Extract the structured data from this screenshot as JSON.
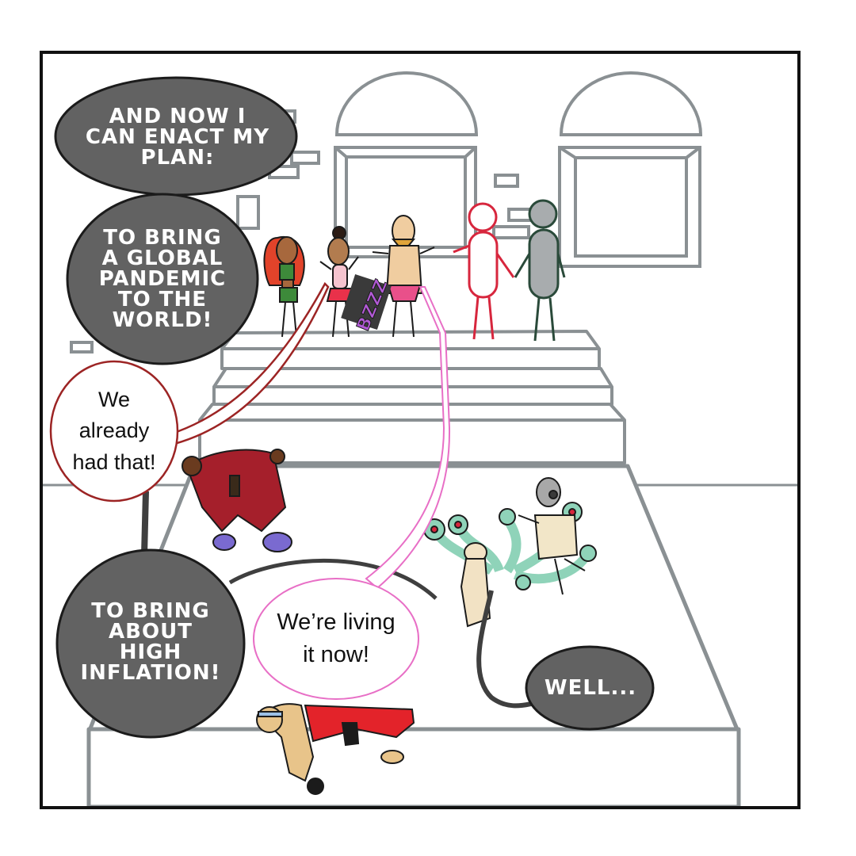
{
  "colors": {
    "caption_fill": "#626262",
    "caption_text": "#ffffff",
    "building_line": "#8a9093",
    "panel_border": "#111111",
    "speech_red": "#9c2424",
    "speech_pink": "#e86fc6"
  },
  "captions": {
    "top": "And now I\ncan enact my\nplan:",
    "pandemic": "To bring\na global\npandemic\nto the\nworld!",
    "inflation": "To bring\nabout\nhigh\ninflation!",
    "well": "Well..."
  },
  "speech": {
    "already": "We\nalready\nhad that!",
    "living": "We’re living\nit now!"
  },
  "sfx": {
    "buzz": "BZZZ"
  }
}
